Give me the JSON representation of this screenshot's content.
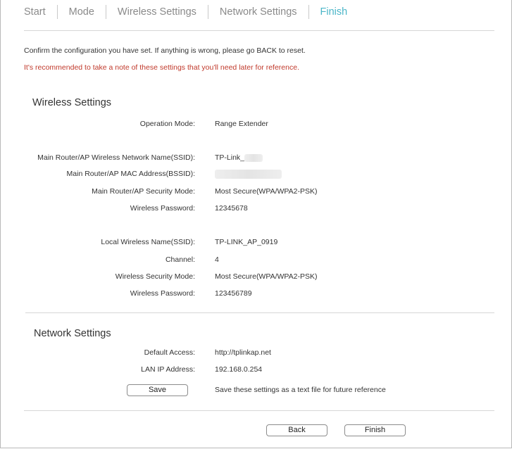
{
  "steps": [
    {
      "label": "Start",
      "active": false
    },
    {
      "label": "Mode",
      "active": false
    },
    {
      "label": "Wireless Settings",
      "active": false
    },
    {
      "label": "Network Settings",
      "active": false
    },
    {
      "label": "Finish",
      "active": true
    }
  ],
  "messages": {
    "confirm": "Confirm the configuration you have set. If anything is wrong, please go BACK to reset.",
    "recommend": "It's recommended to take a note of these settings that you'll need later for reference."
  },
  "colors": {
    "active_step": "#4bb6c8",
    "warning_text": "#c0392b",
    "divider": "#d6d6d6"
  },
  "wireless": {
    "title": "Wireless Settings",
    "operation_mode": {
      "label": "Operation Mode:",
      "value": "Range Extender"
    },
    "main_ssid": {
      "label": "Main Router/AP Wireless Network Name(SSID):",
      "value": "TP-Link_"
    },
    "main_bssid": {
      "label": "Main Router/AP MAC Address(BSSID):",
      "value": ""
    },
    "main_security": {
      "label": "Main Router/AP Security Mode:",
      "value": "Most Secure(WPA/WPA2-PSK)"
    },
    "main_password": {
      "label": "Wireless Password:",
      "value": "12345678"
    },
    "local_ssid": {
      "label": "Local Wireless Name(SSID):",
      "value": "TP-LINK_AP_0919"
    },
    "channel": {
      "label": "Channel:",
      "value": "4"
    },
    "local_security": {
      "label": "Wireless Security Mode:",
      "value": "Most Secure(WPA/WPA2-PSK)"
    },
    "local_password": {
      "label": "Wireless Password:",
      "value": "123456789"
    }
  },
  "network": {
    "title": "Network Settings",
    "default_access": {
      "label": "Default Access:",
      "value": "http://tplinkap.net"
    },
    "lan_ip": {
      "label": "LAN IP Address:",
      "value": "192.168.0.254"
    }
  },
  "save": {
    "button_label": "Save",
    "note": "Save these settings as a text file for future reference"
  },
  "footer": {
    "back_label": "Back",
    "finish_label": "Finish"
  }
}
